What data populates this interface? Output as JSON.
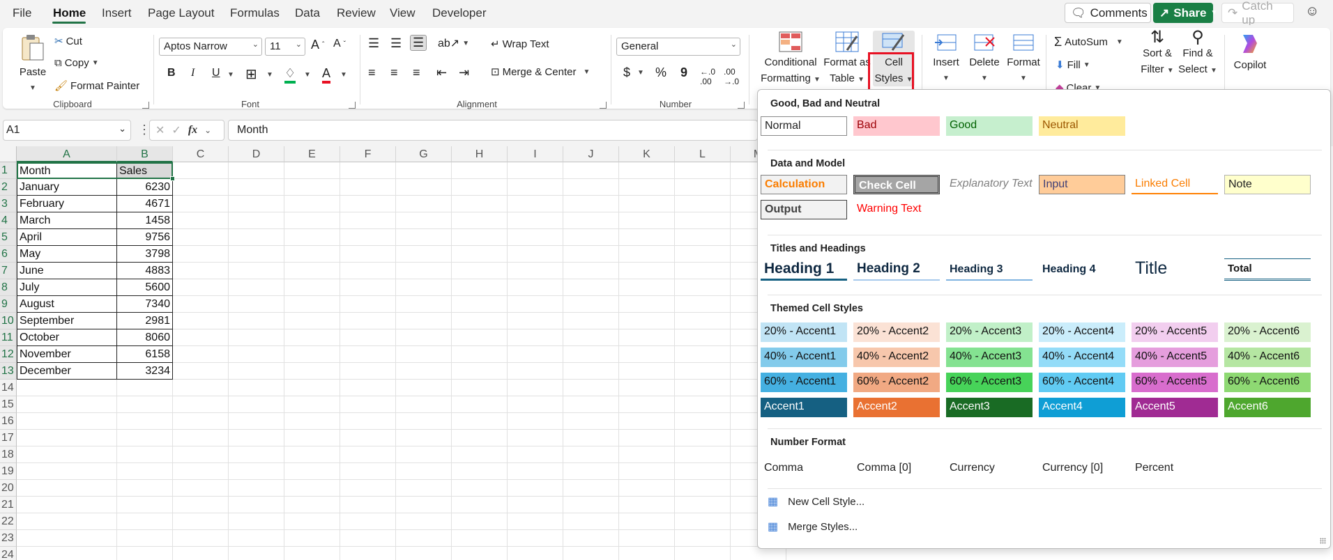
{
  "menu": {
    "items": [
      "File",
      "Home",
      "Insert",
      "Page Layout",
      "Formulas",
      "Data",
      "Review",
      "View",
      "Developer"
    ],
    "active": "Home",
    "comments_label": "Comments",
    "share_label": "Share",
    "catchup_label": "Catch up"
  },
  "ribbon": {
    "clipboard": {
      "paste": "Paste",
      "cut": "Cut",
      "copy": "Copy",
      "format_painter": "Format Painter",
      "label": "Clipboard"
    },
    "font": {
      "font_name": "Aptos Narrow",
      "font_size": "11",
      "bold": "B",
      "italic": "I",
      "underline": "U",
      "label": "Font"
    },
    "alignment": {
      "wrap_text": "Wrap Text",
      "merge_center": "Merge & Center",
      "label": "Alignment"
    },
    "number": {
      "format": "General",
      "currency": "$",
      "percent": "%",
      "comma": "9",
      "label": "Number"
    },
    "styles": {
      "conditional_formatting_1": "Conditional",
      "conditional_formatting_2": "Formatting",
      "format_table_1": "Format as",
      "format_table_2": "Table",
      "cell_styles_1": "Cell",
      "cell_styles_2": "Styles"
    },
    "cells": {
      "insert": "Insert",
      "delete": "Delete",
      "format": "Format"
    },
    "editing": {
      "autosum": "AutoSum",
      "fill": "Fill",
      "clear": "Clear",
      "sort_filter_1": "Sort &",
      "sort_filter_2": "Filter",
      "find_select_1": "Find &",
      "find_select_2": "Select"
    },
    "copilot": "Copilot"
  },
  "formula_bar": {
    "name_box": "A1",
    "content": "Month",
    "fx": "fx"
  },
  "sheet": {
    "columns": [
      "A",
      "B",
      "C",
      "D",
      "E",
      "F",
      "G",
      "H",
      "I",
      "J",
      "K",
      "L",
      "M"
    ],
    "rows": [
      "1",
      "2",
      "3",
      "4",
      "5",
      "6",
      "7",
      "8",
      "9",
      "10",
      "11",
      "12",
      "13",
      "14",
      "15",
      "16",
      "17",
      "18",
      "19",
      "20",
      "21",
      "22",
      "23",
      "24"
    ],
    "headers": [
      "Month",
      "Sales"
    ],
    "data": [
      [
        "January",
        "6230"
      ],
      [
        "February",
        "4671"
      ],
      [
        "March",
        "1458"
      ],
      [
        "April",
        "9756"
      ],
      [
        "May",
        "3798"
      ],
      [
        "June",
        "4883"
      ],
      [
        "July",
        "5600"
      ],
      [
        "August",
        "7340"
      ],
      [
        "September",
        "2981"
      ],
      [
        "October",
        "8060"
      ],
      [
        "November",
        "6158"
      ],
      [
        "December",
        "3234"
      ]
    ]
  },
  "cell_styles": {
    "sections": {
      "good_bad": "Good, Bad and Neutral",
      "data_model": "Data and Model",
      "titles": "Titles and Headings",
      "themed": "Themed Cell Styles",
      "number": "Number Format"
    },
    "good_bad": [
      "Normal",
      "Bad",
      "Good",
      "Neutral"
    ],
    "data_model": [
      "Calculation",
      "Check Cell",
      "Explanatory Text",
      "Input",
      "Linked Cell",
      "Note",
      "Output",
      "Warning Text"
    ],
    "titles": [
      "Heading 1",
      "Heading 2",
      "Heading 3",
      "Heading 4",
      "Title",
      "Total"
    ],
    "themed": [
      [
        "20% - Accent1",
        "20% - Accent2",
        "20% - Accent3",
        "20% - Accent4",
        "20% - Accent5",
        "20% - Accent6"
      ],
      [
        "40% - Accent1",
        "40% - Accent2",
        "40% - Accent3",
        "40% - Accent4",
        "40% - Accent5",
        "40% - Accent6"
      ],
      [
        "60% - Accent1",
        "60% - Accent2",
        "60% - Accent3",
        "60% - Accent4",
        "60% - Accent5",
        "60% - Accent6"
      ],
      [
        "Accent1",
        "Accent2",
        "Accent3",
        "Accent4",
        "Accent5",
        "Accent6"
      ]
    ],
    "number_format": [
      "Comma",
      "Comma [0]",
      "Currency",
      "Currency [0]",
      "Percent"
    ],
    "footer": {
      "new_style": "New Cell Style...",
      "merge_styles": "Merge Styles..."
    }
  },
  "colors": {
    "accent_green": "#217346",
    "highlight_red": "#e81123",
    "share_green": "#1a7f45"
  }
}
